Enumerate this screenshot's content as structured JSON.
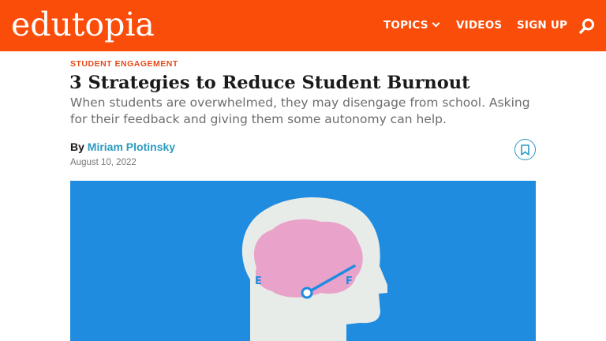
{
  "header": {
    "logo_text": "edutopia",
    "nav": {
      "topics": "TOPICS",
      "videos": "VIDEOS",
      "signup": "SIGN UP"
    },
    "search_icon": "search-icon",
    "brand_color": "#fa4d09"
  },
  "article": {
    "kicker": "STUDENT ENGAGEMENT",
    "title": "3 Strategies to Reduce Student Burnout",
    "dek": "When students are overwhelmed, they may disengage from school. Asking for their feedback and giving them some autonomy can help.",
    "byline_prefix": "By",
    "author": "Miriam Plotinsky",
    "date": "August 10, 2022",
    "bookmark_icon": "bookmark-icon"
  },
  "hero": {
    "gauge_empty_label": "E",
    "gauge_full_label": "F",
    "background_color": "#1f8ce0",
    "brain_color": "#e9a2c9"
  }
}
